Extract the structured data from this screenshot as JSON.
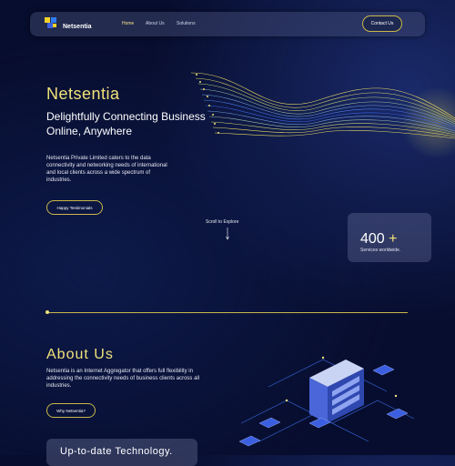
{
  "nav": {
    "logo_text": "Netsentia",
    "links": [
      "Home",
      "About Us",
      "Solutions"
    ],
    "contact_label": "Contact Us"
  },
  "hero": {
    "title": "Netsentia",
    "subtitle": "Delightfully Connecting Business Online, Anywhere",
    "description": "Netsentia Private Limited caters to the data connectivity and networking needs of international and local clients across a wide spectrum of industries.",
    "button_label": "Happy Testimonials",
    "scroll_label": "Scroll to Explore"
  },
  "stat": {
    "number": "400",
    "plus": "+",
    "label": "Services worldwide."
  },
  "about": {
    "title": "About Us",
    "description": "Netsentia is an Internet Aggregator that offers full flexibility in addressing the connectivity needs of business clients across all industries.",
    "button_label": "Why Netsentia?"
  },
  "tech": {
    "title": "Up-to-date Technology."
  },
  "colors": {
    "background": "#070d2e",
    "accent": "#f0e27a",
    "button_border": "#c9b84a"
  },
  "icons": [
    "logo-cube-icon",
    "down-arrow-icon"
  ]
}
